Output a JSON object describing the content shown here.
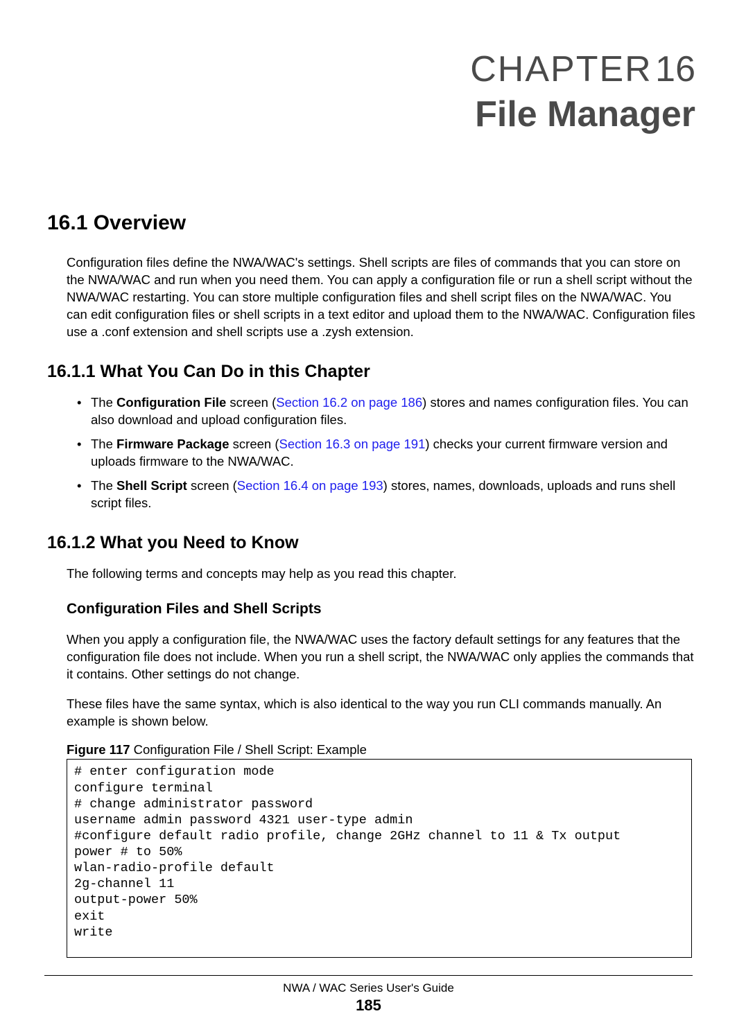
{
  "chapter": {
    "label_prefix": "C",
    "label_rest": "HAPTER",
    "number": "16",
    "title": "File Manager"
  },
  "section_16_1": {
    "heading": "16.1  Overview",
    "paragraph": "Configuration files define the NWA/WAC's settings. Shell scripts are files of commands that you can store on the NWA/WAC and run when you need them. You can apply a configuration file or run a shell script without the NWA/WAC restarting. You can store multiple configuration files and shell script files on the NWA/WAC. You can edit configuration files or shell scripts in a text editor and upload them to the NWA/WAC. Configuration files use a .conf extension and shell scripts use a .zysh extension."
  },
  "section_16_1_1": {
    "heading": "16.1.1  What You Can Do in this Chapter",
    "bullets": [
      {
        "prefix": "The ",
        "bold": "Configuration File",
        "mid": " screen (",
        "link": "Section 16.2 on page 186",
        "suffix": ") stores and names configuration files. You can also download and upload configuration files."
      },
      {
        "prefix": "The ",
        "bold": "Firmware Package",
        "mid": " screen (",
        "link": "Section 16.3 on page 191",
        "suffix": ") checks your current firmware version and uploads firmware to the NWA/WAC."
      },
      {
        "prefix": "The ",
        "bold": "Shell Script",
        "mid": " screen (",
        "link": "Section 16.4 on page 193",
        "suffix": ") stores, names, downloads, uploads and runs shell script files."
      }
    ]
  },
  "section_16_1_2": {
    "heading": "16.1.2  What you Need to Know",
    "intro": "The following terms and concepts may help as you read this chapter.",
    "subheading": "Configuration Files and Shell Scripts",
    "para1": "When you apply a configuration file, the NWA/WAC uses the factory default settings for any features that the configuration file does not include. When you run a shell script, the NWA/WAC only applies the commands that it contains. Other settings do not change.",
    "para2": "These files have the same syntax, which is also identical to the way you run CLI commands manually. An example is shown below."
  },
  "figure": {
    "label_bold": "Figure 117",
    "label_rest": "   Configuration File / Shell Script: Example",
    "code": "# enter configuration mode\nconfigure terminal\n# change administrator password\nusername admin password 4321 user-type admin\n#configure default radio profile, change 2GHz channel to 11 & Tx output \npower # to 50%\nwlan-radio-profile default\n2g-channel 11\noutput-power 50%\nexit\nwrite"
  },
  "footer": {
    "guide": "NWA / WAC Series User's Guide",
    "page": "185"
  }
}
